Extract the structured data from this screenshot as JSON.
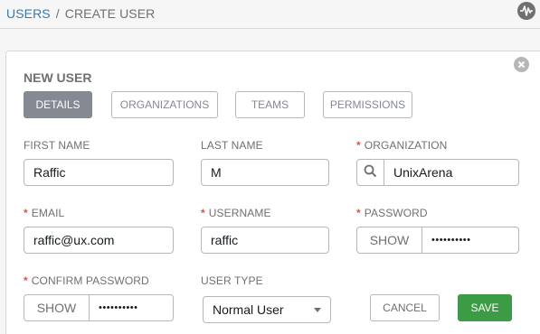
{
  "breadcrumb": {
    "root": "USERS",
    "separator": "/",
    "current": "CREATE USER"
  },
  "header_icon": "activity-stream-icon",
  "panel": {
    "title": "NEW USER",
    "close_icon": "close-icon",
    "tabs": [
      {
        "label": "DETAILS",
        "active": true
      },
      {
        "label": "ORGANIZATIONS",
        "active": false
      },
      {
        "label": "TEAMS",
        "active": false
      },
      {
        "label": "PERMISSIONS",
        "active": false
      }
    ]
  },
  "form": {
    "first_name": {
      "label": "FIRST NAME",
      "value": "Raffic",
      "required": false
    },
    "last_name": {
      "label": "LAST NAME",
      "value": "M",
      "required": false
    },
    "organization": {
      "label": "ORGANIZATION",
      "value": "UnixArena",
      "required": true,
      "required_mark": "*",
      "addon_icon": "search-icon"
    },
    "email": {
      "label": "EMAIL",
      "value": "raffic@ux.com",
      "required": true,
      "required_mark": "*"
    },
    "username": {
      "label": "USERNAME",
      "value": "raffic",
      "required": true,
      "required_mark": "*"
    },
    "password": {
      "label": "PASSWORD",
      "value": "••••••••••",
      "required": true,
      "required_mark": "*",
      "show_label": "SHOW"
    },
    "confirm_password": {
      "label": "CONFIRM PASSWORD",
      "value": "••••••••••",
      "required": true,
      "required_mark": "*",
      "show_label": "SHOW"
    },
    "user_type": {
      "label": "USER TYPE",
      "value": "Normal User"
    }
  },
  "actions": {
    "cancel_label": "CANCEL",
    "save_label": "SAVE"
  },
  "colors": {
    "link": "#337ab7",
    "required": "#d9534f",
    "save": "#3c9b45",
    "active_tab": "#848992"
  }
}
